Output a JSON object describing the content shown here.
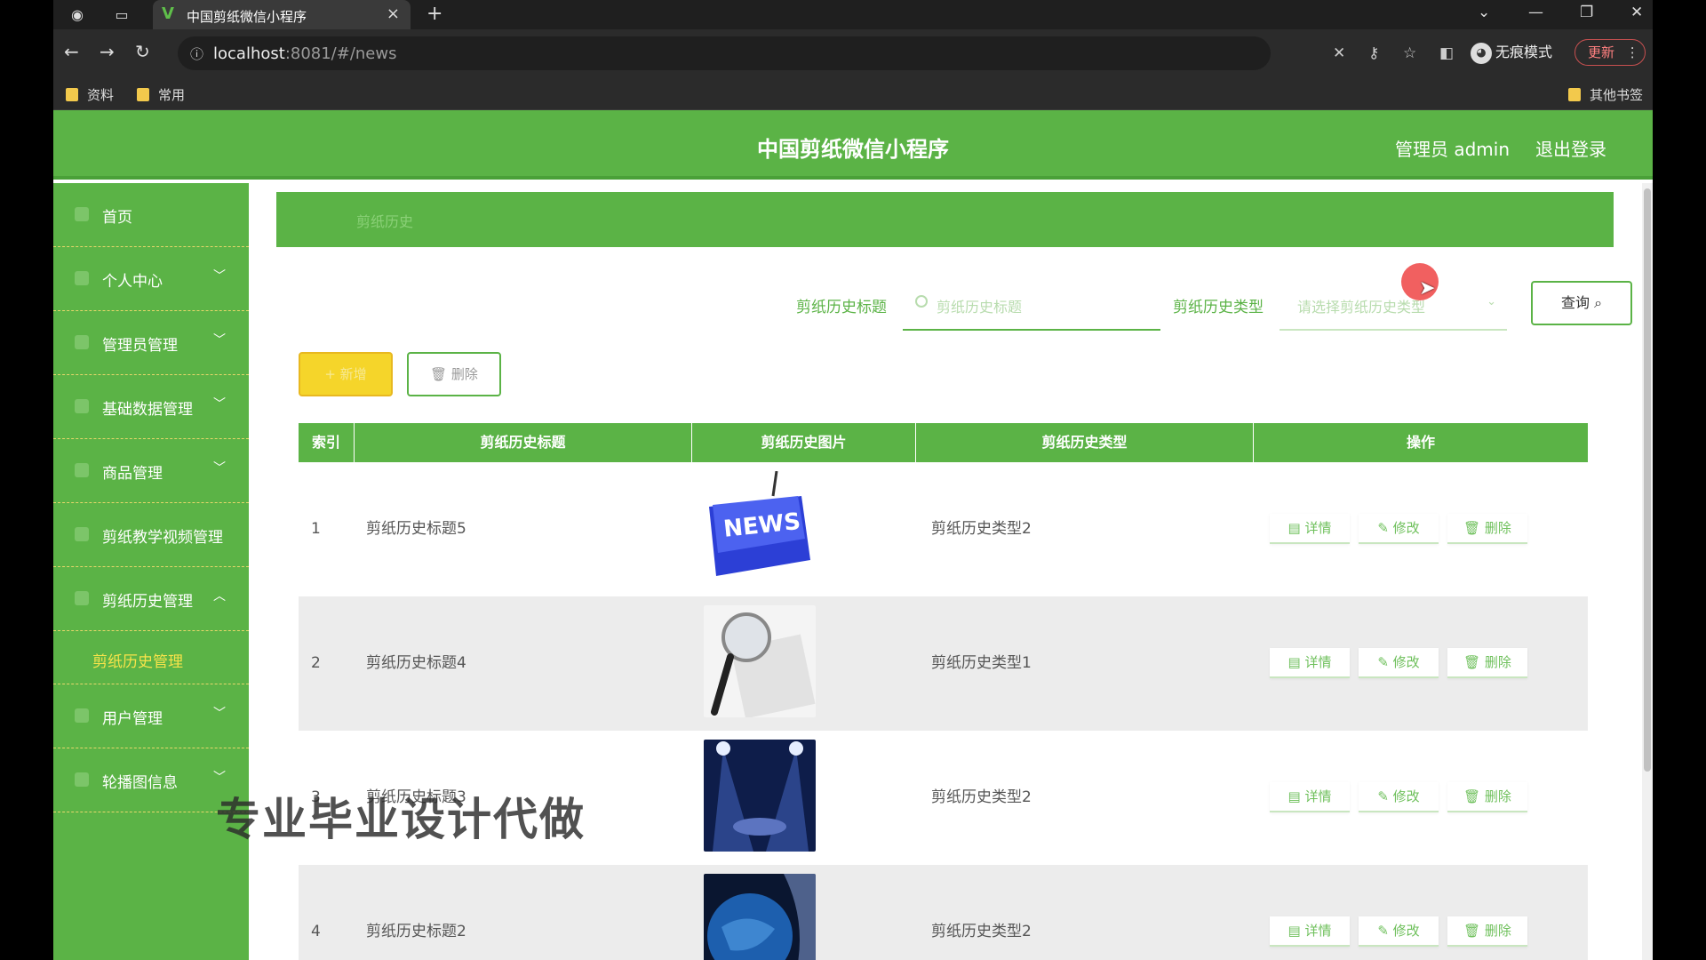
{
  "browser": {
    "tab_title": "中国剪纸微信小程序",
    "url_host": "localhost",
    "url_rest": ":8081/#/news",
    "incognito_label": "无痕模式",
    "update_label": "更新",
    "bookmarks": [
      "资料",
      "常用"
    ],
    "other_bookmarks": "其他书签"
  },
  "header": {
    "title": "中国剪纸微信小程序",
    "user": "管理员 admin",
    "logout": "退出登录"
  },
  "sidebar": {
    "items": [
      {
        "label": "首页"
      },
      {
        "label": "个人中心"
      },
      {
        "label": "管理员管理"
      },
      {
        "label": "基础数据管理"
      },
      {
        "label": "商品管理"
      },
      {
        "label": "剪纸教学视频管理"
      },
      {
        "label": "剪纸历史管理"
      },
      {
        "label": "用户管理"
      },
      {
        "label": "轮播图信息"
      }
    ],
    "sub_item": "剪纸历史管理"
  },
  "breadcrumb": "剪纸历史",
  "search": {
    "title_label": "剪纸历史标题",
    "title_placeholder": "剪纸历史标题",
    "type_label": "剪纸历史类型",
    "type_placeholder": "请选择剪纸历史类型",
    "query_label": "查询"
  },
  "actions": {
    "add": "新增",
    "delete": "删除"
  },
  "table": {
    "headers": [
      "索引",
      "剪纸历史标题",
      "剪纸历史图片",
      "剪纸历史类型",
      "操作"
    ],
    "rows": [
      {
        "index": "1",
        "title": "剪纸历史标题5",
        "type": "剪纸历史类型2",
        "image": "news-keyboard"
      },
      {
        "index": "2",
        "title": "剪纸历史标题4",
        "type": "剪纸历史类型1",
        "image": "news-magnifier"
      },
      {
        "index": "3",
        "title": "剪纸历史标题3",
        "type": "剪纸历史类型2",
        "image": "stage-spotlights"
      },
      {
        "index": "4",
        "title": "剪纸历史标题2",
        "type": "剪纸历史类型2",
        "image": "globe"
      }
    ],
    "ops": [
      "详情",
      "修改",
      "删除"
    ]
  },
  "watermark": "专业毕业设计代做",
  "colors": {
    "primary": "#5bb346",
    "accent": "#f5d52a"
  }
}
